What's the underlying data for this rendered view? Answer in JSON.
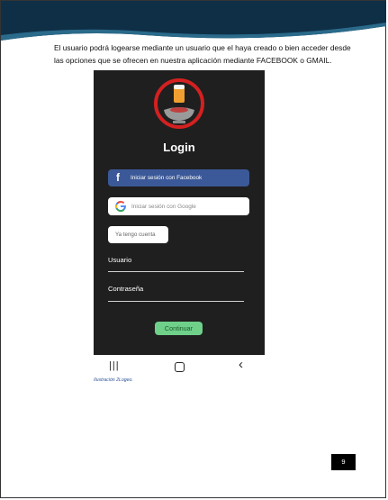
{
  "document": {
    "paragraph": "El usuario podrá logearse  mediante un usuario que el haya creado o bien acceder desde las opciones que se ofrecen en nuestra aplicación mediante FACEBOOK o GMAIL.",
    "caption": "Ilustración 2Logeo.",
    "page_number": "9"
  },
  "app": {
    "title": "Login",
    "facebook_label": "Iniciar sesión con Facebook",
    "google_label": "Iniciar sesión con Google",
    "have_account_label": "Ya tengo cuenta",
    "username_label": "Usuario",
    "password_label": "Contraseña",
    "continue_label": "Continuar"
  },
  "colors": {
    "header_dark": "#0f2f46",
    "header_accent": "#2a6a8a",
    "phone_bg": "#1f1f1f",
    "facebook_blue": "#3b5998",
    "logo_ring_red": "#d42020",
    "continue_green": "#6fd08a",
    "caption_blue": "#2f5597"
  },
  "icons": [
    "logo-icon",
    "facebook-icon",
    "google-icon",
    "recents-icon",
    "home-icon",
    "back-icon"
  ]
}
